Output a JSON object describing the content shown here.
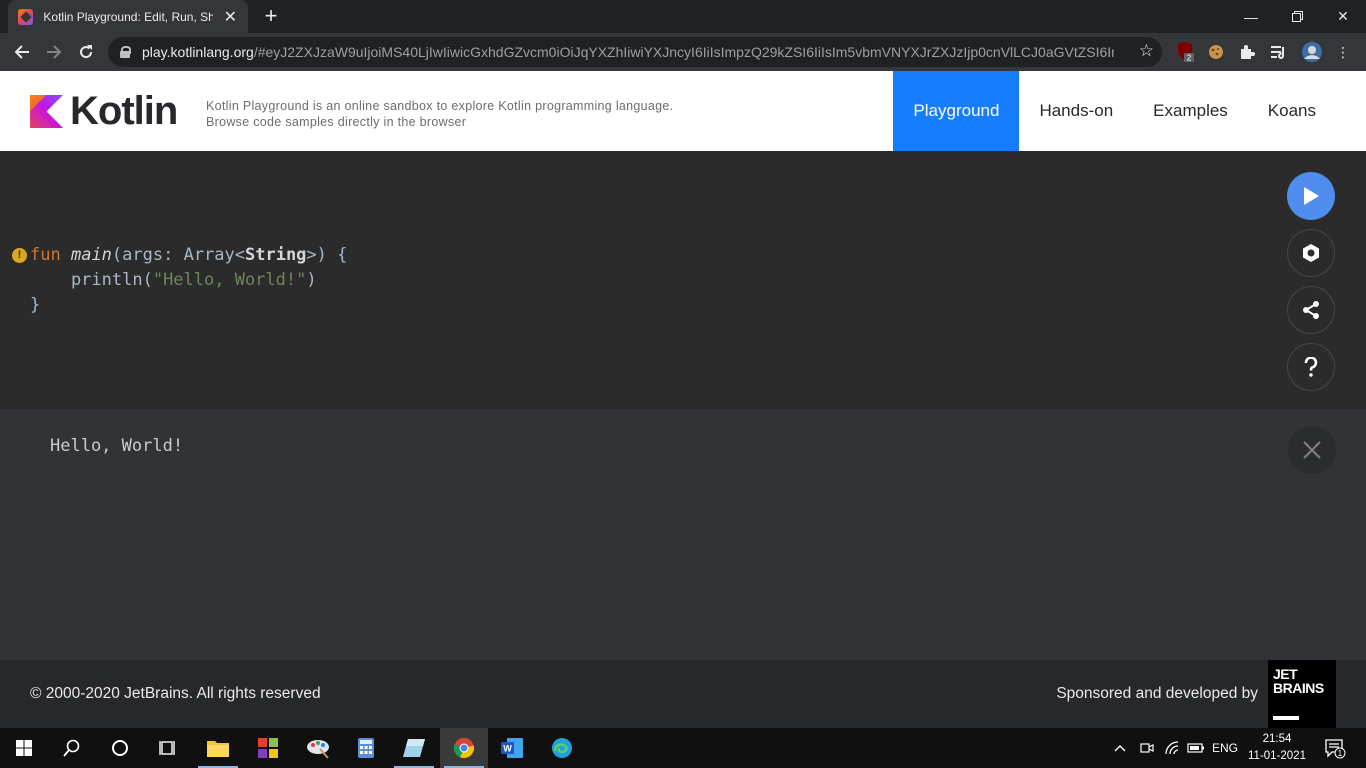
{
  "browser": {
    "tab_title": "Kotlin Playground: Edit, Run, Share Kotlin Code Online",
    "new_tab": "+",
    "url_host": "play.kotlinlang.org",
    "url_rest": "/#eyJ2ZXJzaW9uIjoiMS40LjIwIiwicGxhdGZvcm0iOiJqYXZhIiwiYXJncyI6IiIsImpzQ29kZSI6IiIsIm5vbmVNYXJrZXJzIjp0cnVlLCJ0aGVtZSI6ImlkZ...",
    "ext_badge": "2"
  },
  "header": {
    "logo_text": "Kotlin",
    "tagline": "Kotlin Playground is an online sandbox to explore Kotlin programming language. Browse code samples directly in the browser",
    "nav": [
      {
        "label": "Playground",
        "active": true
      },
      {
        "label": "Hands-on",
        "active": false
      },
      {
        "label": "Examples",
        "active": false
      },
      {
        "label": "Koans",
        "active": false
      }
    ]
  },
  "editor": {
    "line1": {
      "kw": "fun",
      "name": "main",
      "open": "(args: ",
      "type": "Array<",
      "type_arg": "String",
      "close": ">) {"
    },
    "line2": {
      "call": "    println(",
      "str": "\"Hello, World!\"",
      "end": ")"
    },
    "line3": "}",
    "warning_glyph": "!"
  },
  "output": {
    "text": "Hello, World!"
  },
  "footer": {
    "copyright": "© 2000-2020 JetBrains. All rights reserved",
    "sponsor": "Sponsored and developed by",
    "jb_line1": "JET",
    "jb_line2": "BRAINS"
  },
  "taskbar": {
    "lang": "ENG",
    "time": "21:54",
    "date": "11-01-2021",
    "notification_count": "1"
  },
  "colors": {
    "accent": "#167dff",
    "run_button": "#4e8ded",
    "editor_bg": "#2b2b2b",
    "output_bg": "#323336",
    "footer_bg": "#27282c"
  }
}
